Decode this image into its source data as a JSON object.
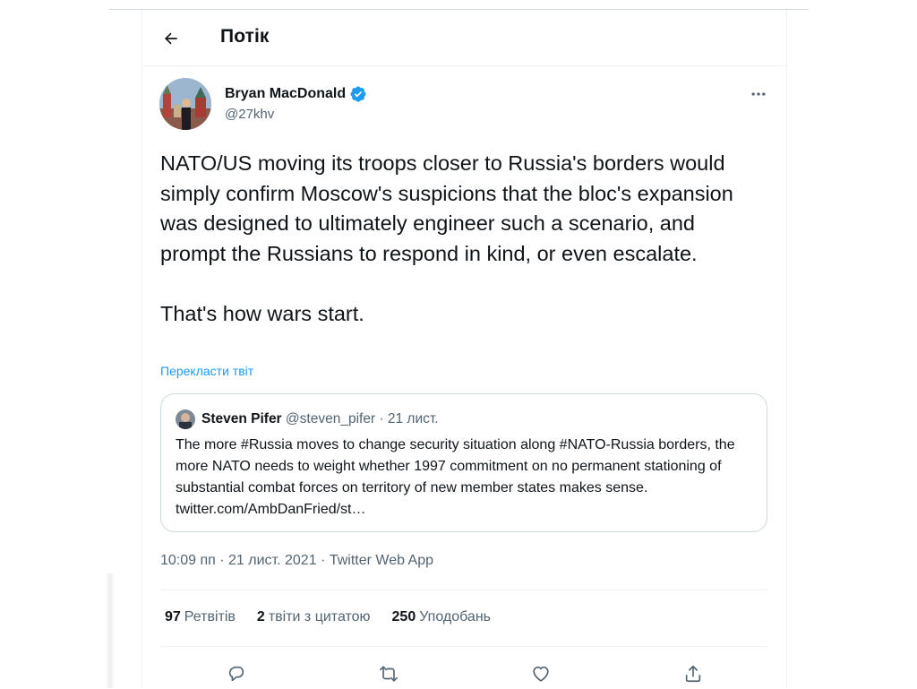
{
  "header": {
    "title": "Потік",
    "back_icon": "arrow-left-icon"
  },
  "tweet": {
    "author_name": "Bryan MacDonald",
    "author_handle": "@27khv",
    "verified_icon": "verified-badge-icon",
    "text": "NATO/US moving its troops closer to Russia's borders would simply confirm Moscow's suspicions that the bloc's expansion was designed to ultimately engineer such a scenario, and prompt the Russians to respond in kind, or even escalate.\n\nThat's how wars start.",
    "translate_label": "Перекласти твіт",
    "timestamp": "10:09 пп · 21 лист. 2021",
    "separator": " · ",
    "source": "Twitter Web App"
  },
  "quote": {
    "author_name": "Steven Pifer",
    "author_handle": "@steven_pifer",
    "date": " · 21 лист.",
    "text": "The more #Russia moves to change security situation along #NATO-Russia borders, the more NATO needs to weight whether 1997 commitment on no permanent stationing of substantial combat forces on territory of new member states makes sense. twitter.com/AmbDanFried/st…"
  },
  "stats": {
    "retweets_count": "97",
    "retweets_label": "Ретвітів",
    "quotes_count": "2",
    "quotes_label": "твіти з цитатою",
    "likes_count": "250",
    "likes_label": "Уподобань"
  },
  "actions": [
    "reply-icon",
    "retweet-icon",
    "like-icon",
    "share-icon"
  ],
  "colors": {
    "accent": "#1d9bf0",
    "text": "#0f1419",
    "secondary": "#536471",
    "border": "#eff3f4"
  }
}
